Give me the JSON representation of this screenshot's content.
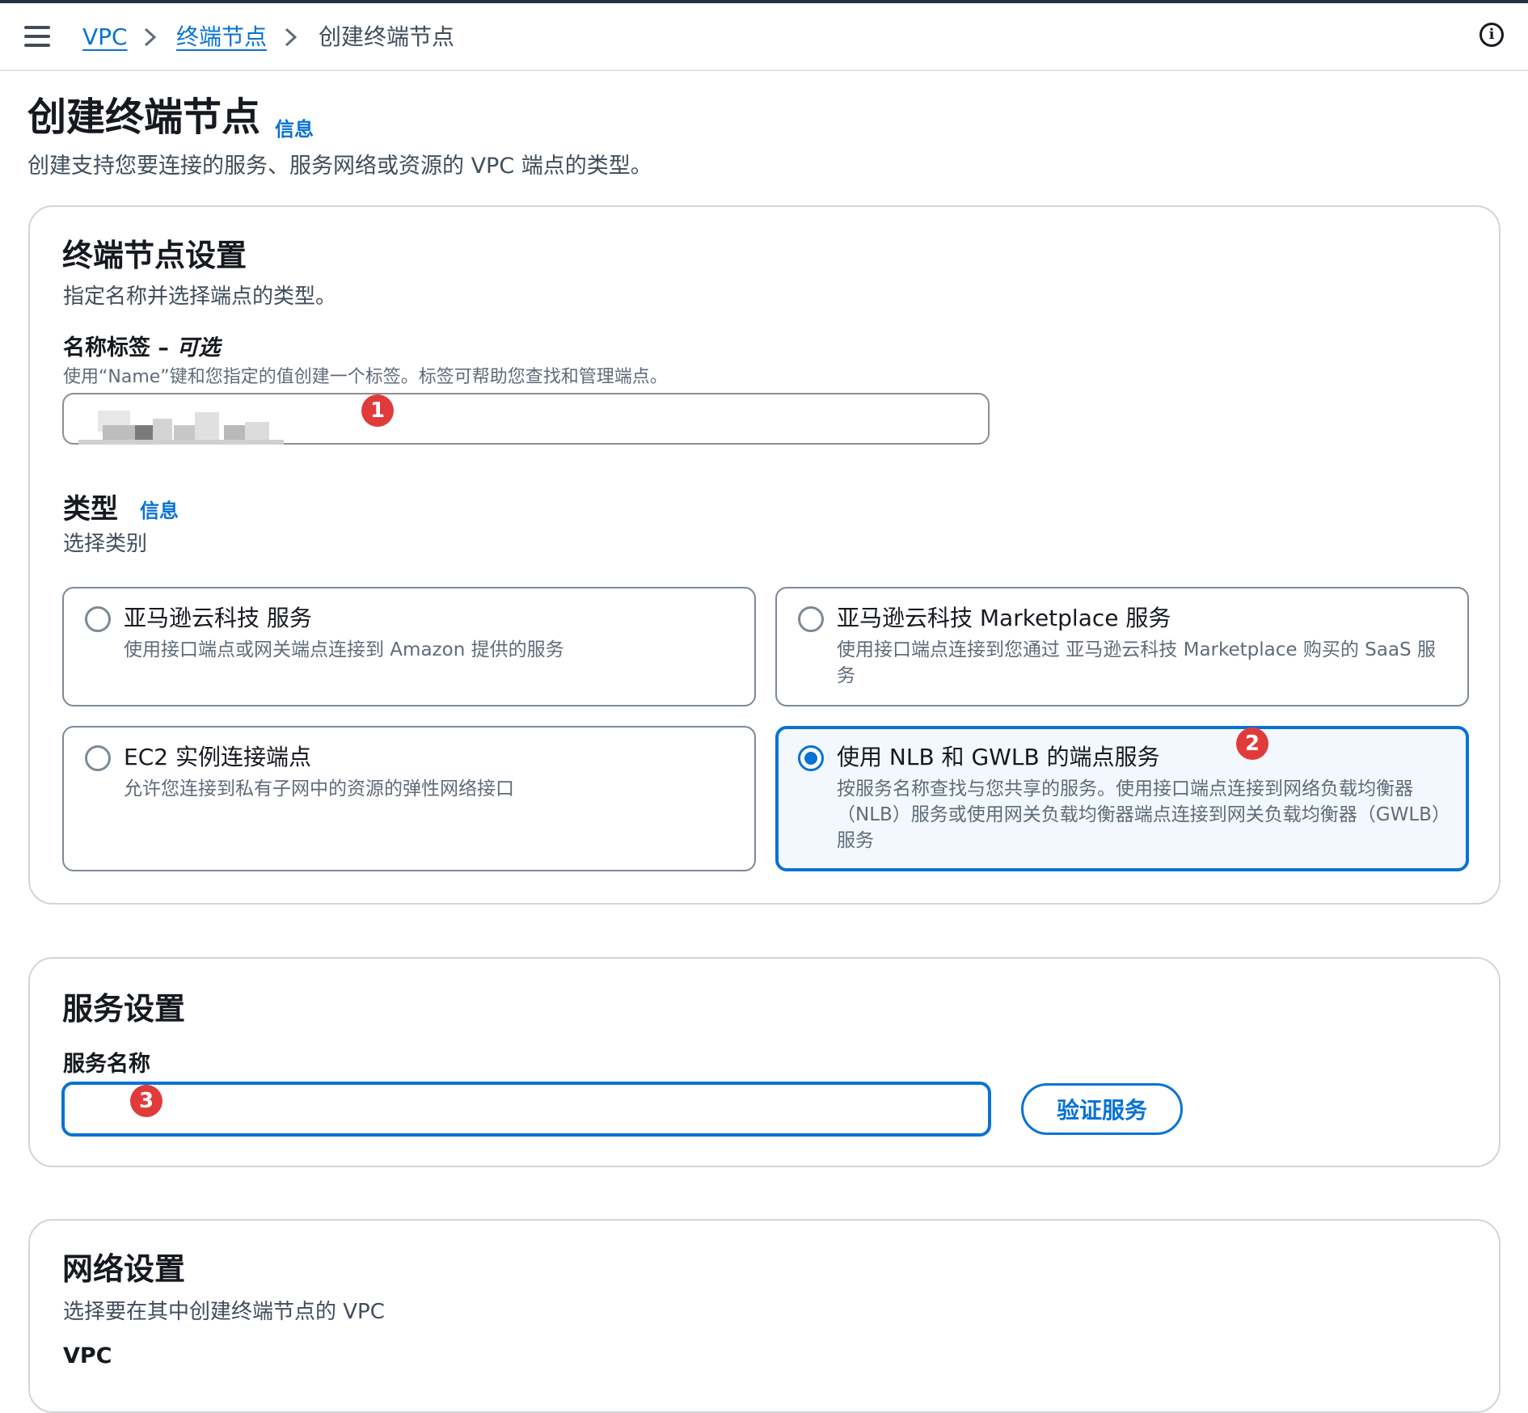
{
  "breadcrumb": {
    "items": [
      {
        "label": "VPC"
      },
      {
        "label": "终端节点"
      },
      {
        "label": "创建终端节点"
      }
    ],
    "separator": ">"
  },
  "header": {
    "title": "创建终端节点",
    "info_label": "信息",
    "description": "创建支持您要连接的服务、服务网络或资源的 VPC 端点的类型。"
  },
  "endpoint_settings": {
    "title": "终端节点设置",
    "description": "指定名称并选择端点的类型。",
    "name_tag": {
      "label": "名称标签 – ",
      "optional": "可选",
      "hint": "使用“Name”键和您指定的值创建一个标签。标签可帮助您查找和管理端点。"
    },
    "type": {
      "label": "类型",
      "info_label": "信息",
      "description": "选择类别",
      "options": [
        {
          "title": "亚马逊云科技 服务",
          "description": "使用接口端点或网关端点连接到 Amazon 提供的服务",
          "selected": false
        },
        {
          "title": "亚马逊云科技 Marketplace 服务",
          "description": "使用接口端点连接到您通过 亚马逊云科技 Marketplace 购买的 SaaS 服务",
          "selected": false
        },
        {
          "title": "EC2 实例连接端点",
          "description": "允许您连接到私有子网中的资源的弹性网络接口",
          "selected": false
        },
        {
          "title": "使用 NLB 和 GWLB 的端点服务",
          "description": "按服务名称查找与您共享的服务。使用接口端点连接到网络负载均衡器（NLB）服务或使用网关负载均衡器端点连接到网关负载均衡器（GWLB）服务",
          "selected": true
        }
      ]
    }
  },
  "service_settings": {
    "title": "服务设置",
    "service_name_label": "服务名称",
    "verify_button": "验证服务"
  },
  "network_settings": {
    "title": "网络设置",
    "description": "选择要在其中创建终端节点的 VPC",
    "vpc_label": "VPC"
  },
  "annotations": [
    "1",
    "2",
    "3"
  ],
  "colors": {
    "accent": "#0972d3",
    "badge": "#e03b3b",
    "text": "#16191f",
    "border": "#d1d5db"
  },
  "icons": {
    "menu": "hamburger-menu-icon",
    "info": "info-circle-icon",
    "separator": "chevron-right-icon"
  }
}
